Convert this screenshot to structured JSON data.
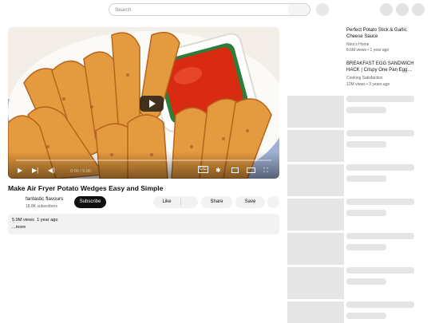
{
  "header": {
    "search_placeholder": "Search"
  },
  "player": {
    "time": "0:00 / 5:00",
    "icons": [
      "play-icon",
      "next-icon",
      "volume-icon",
      "subtitles-icon",
      "settings-icon",
      "miniplayer-icon",
      "theater-icon",
      "fullscreen-icon"
    ]
  },
  "video": {
    "title": "Make Air Fryer Potato Wedges Easy and Simple",
    "channel_name": "fantastic flavours",
    "subscribers": "18.8K subscribers",
    "subscribe_label": "Subscribe",
    "like_label": "Like",
    "share_label": "Share",
    "save_label": "Save",
    "views": "5.9M views",
    "age": "1 year ago",
    "more_label": "...more"
  },
  "recommendations": [
    {
      "title": "Perfect Potato Stick & Garlic Cheese Sauce",
      "channel": "Nino's Home",
      "meta": "8.6M views • 1 year ago"
    },
    {
      "title": "BREAKFAST EGG SANDWICH HACK | Crispy One Pan Egg…",
      "channel": "Cooking Satisfaction",
      "meta": "12M views • 3 years ago"
    }
  ],
  "colors": {
    "subscribe_bg": "#0f0f0f",
    "placeholder": "#e5e5e5",
    "pill_bg": "#f2f2f2"
  }
}
